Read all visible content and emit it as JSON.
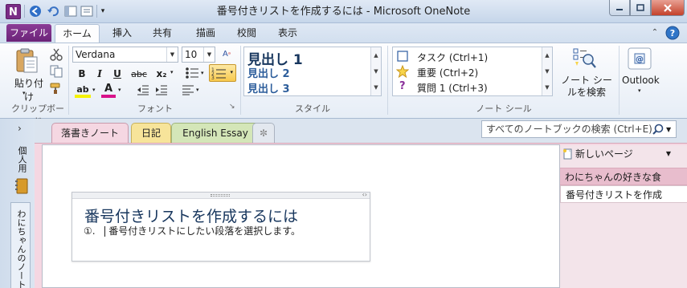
{
  "window": {
    "title": "番号付きリストを作成するには - Microsoft OneNote",
    "app_icon": "N",
    "accent_color": "#7a2c86"
  },
  "ribbon_tabs": [
    "ファイル",
    "ホーム",
    "挿入",
    "共有",
    "描画",
    "校閲",
    "表示"
  ],
  "clipboard": {
    "paste_label": "貼り付け",
    "group_label": "クリップボード"
  },
  "font": {
    "name": "Verdana",
    "size": "10",
    "bold": "B",
    "italic": "I",
    "underline": "U",
    "strike": "abc",
    "subscript": "x₂",
    "highlight": "ab",
    "fontcolor": "A",
    "group_label": "フォント"
  },
  "styles": {
    "h1": "見出し 1",
    "h2": "見出し 2",
    "h3": "見出し 3",
    "group_label": "スタイル"
  },
  "tags": {
    "items": [
      "タスク (Ctrl+1)",
      "重要 (Ctrl+2)",
      "質問 1 (Ctrl+3)"
    ],
    "note_tags_button": "ノート シールを検索",
    "group_label": "ノート シール"
  },
  "outlook": {
    "label": "Outlook"
  },
  "leftrail": {
    "notebook_label": "個人用",
    "notebook2_label": "わにちゃんのノート"
  },
  "sections": [
    "落書きノート",
    "日記",
    "English Essay"
  ],
  "search": {
    "placeholder": "すべてのノートブックの検索 (Ctrl+E)"
  },
  "pages": {
    "new_page": "新しいページ",
    "items": [
      "わにちゃんの好きな食",
      "番号付きリストを作成"
    ]
  },
  "note": {
    "title": "番号付きリストを作成するには",
    "item_number": "①.",
    "item_text": "番号付きリストにしたい段落を選択します。"
  }
}
